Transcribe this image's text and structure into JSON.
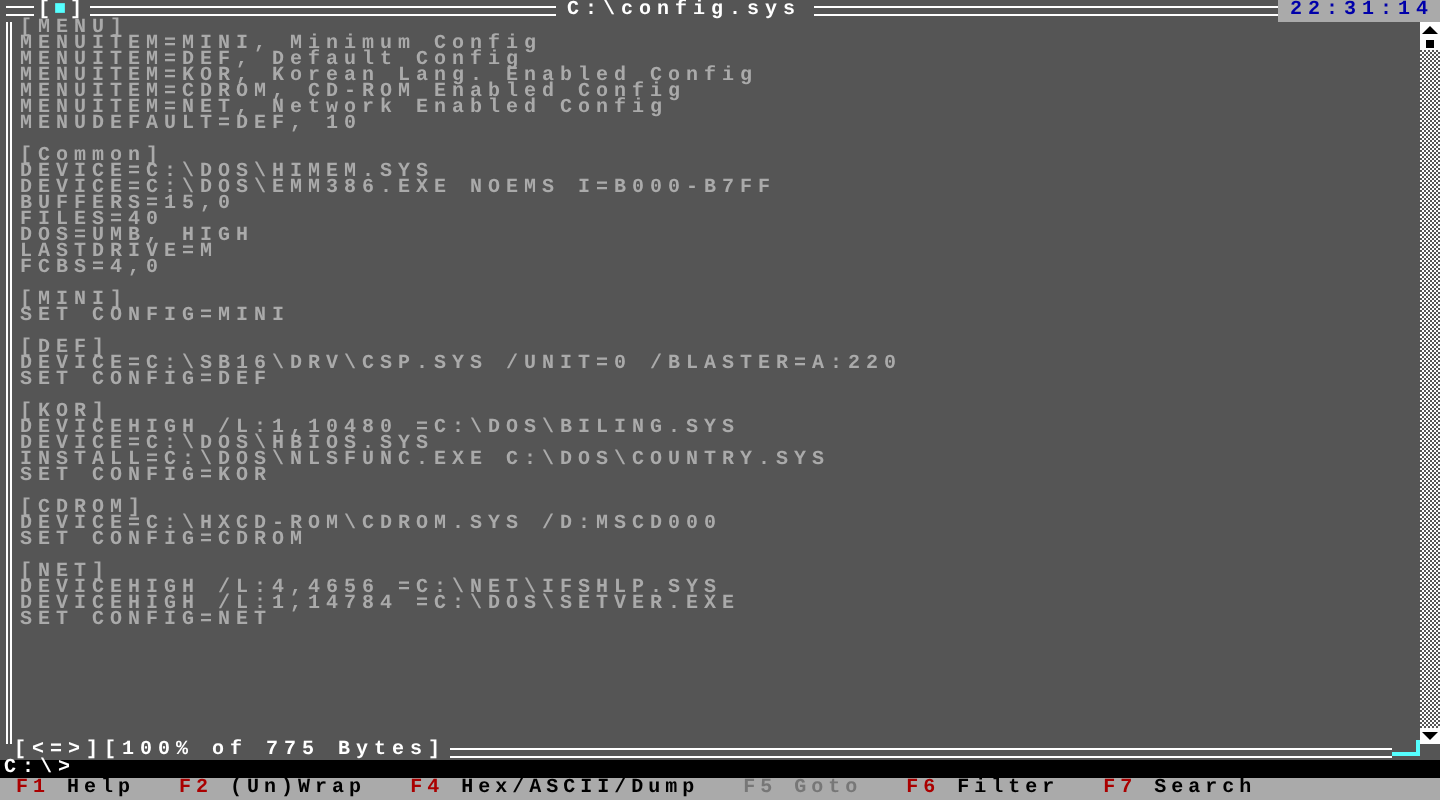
{
  "window": {
    "close_box": "[■]",
    "title": "C:\\config.sys",
    "clock": "22:31:14"
  },
  "sections": [
    {
      "lines": [
        "[MENU]",
        "MENUITEM=MINI, Minimum Config",
        "MENUITEM=DEF, Default Config",
        "MENUITEM=KOR, Korean Lang. Enabled Config",
        "MENUITEM=CDROM, CD-ROM Enabled Config",
        "MENUITEM=NET, Network Enabled Config",
        "MENUDEFAULT=DEF, 10"
      ]
    },
    {
      "lines": [
        "[Common]",
        "DEVICE=C:\\DOS\\HIMEM.SYS",
        "DEVICE=C:\\DOS\\EMM386.EXE NOEMS I=B000-B7FF",
        "BUFFERS=15,0",
        "FILES=40",
        "DOS=UMB, HIGH",
        "LASTDRIVE=M",
        "FCBS=4,0"
      ]
    },
    {
      "lines": [
        "[MINI]",
        "SET CONFIG=MINI"
      ]
    },
    {
      "lines": [
        "[DEF]",
        "DEVICE=C:\\SB16\\DRV\\CSP.SYS /UNIT=0 /BLASTER=A:220",
        "SET CONFIG=DEF"
      ]
    },
    {
      "lines": [
        "[KOR]",
        "DEVICEHIGH /L:1,10480 =C:\\DOS\\BILING.SYS",
        "DEVICE=C:\\DOS\\HBIOS.SYS",
        "INSTALL=C:\\DOS\\NLSFUNC.EXE C:\\DOS\\COUNTRY.SYS",
        "SET CONFIG=KOR"
      ]
    },
    {
      "lines": [
        "[CDROM]",
        "DEVICE=C:\\HXCD-ROM\\CDROM.SYS /D:MSCD000",
        "SET CONFIG=CDROM"
      ]
    },
    {
      "lines": [
        "[NET]",
        "DEVICEHIGH /L:4,4656 =C:\\NET\\IFSHLP.SYS",
        "DEVICEHIGH /L:1,14784 =C:\\DOS\\SETVER.EXE",
        "SET CONFIG=NET"
      ]
    }
  ],
  "status": "[<=>][100% of 775 Bytes]",
  "prompt": "C:\\>",
  "function_keys": [
    {
      "key": "F1",
      "label": "Help",
      "disabled": false
    },
    {
      "key": "F2",
      "label": "(Un)Wrap",
      "disabled": false
    },
    {
      "key": "F4",
      "label": "Hex/ASCII/Dump",
      "disabled": false
    },
    {
      "key": "F5",
      "label": "Goto",
      "disabled": true
    },
    {
      "key": "F6",
      "label": "Filter",
      "disabled": false
    },
    {
      "key": "F7",
      "label": "Search",
      "disabled": false
    }
  ]
}
